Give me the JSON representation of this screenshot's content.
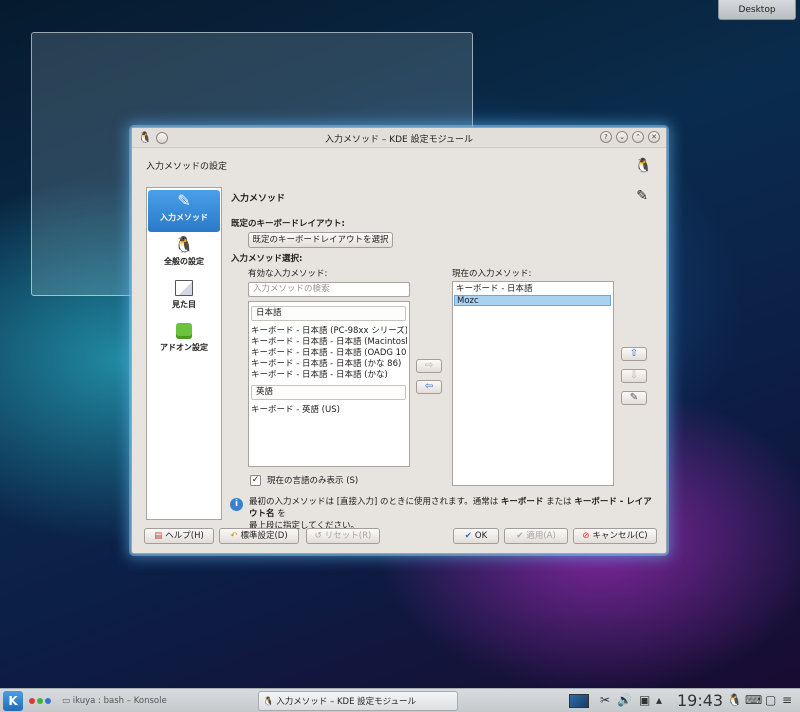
{
  "desktop": {
    "button_label": "Desktop"
  },
  "dialog": {
    "title": "入力メソッド – KDE 設定モジュール",
    "header_label": "入力メソッドの設定",
    "sidebar": [
      {
        "label": "入力メソッド",
        "icon": "pen-icon",
        "selected": true
      },
      {
        "label": "全般の設定",
        "icon": "tux-icon",
        "selected": false
      },
      {
        "label": "見た目",
        "icon": "appearance-icon",
        "selected": false
      },
      {
        "label": "アドオン設定",
        "icon": "puzzle-icon",
        "selected": false
      }
    ],
    "page_title": "入力メソッド",
    "default_layout_label": "既定のキーボードレイアウト:",
    "select_layout_button": "既定のキーボードレイアウトを選択",
    "im_selection_label": "入力メソッド選択:",
    "available_label": "有効な入力メソッド:",
    "search_placeholder": "入力メソッドの検索",
    "available_groups": [
      {
        "header": "日本語",
        "items": [
          "キーボード - 日本語 (PC-98xx シリーズ)",
          "キーボード - 日本語 - 日本語 (Macintosh)",
          "キーボード - 日本語 - 日本語 (OADG 109A)",
          "キーボード - 日本語 - 日本語 (かな 86)",
          "キーボード - 日本語 - 日本語 (かな)"
        ]
      },
      {
        "header": "英語",
        "items": [
          "キーボード - 英語 (US)"
        ]
      }
    ],
    "current_label": "現在の入力メソッド:",
    "current_items": [
      {
        "label": "キーボード - 日本語",
        "selected": false
      },
      {
        "label": "Mozc",
        "selected": true
      }
    ],
    "show_current_lang_only": {
      "label": "現在の言語のみ表示 (S)",
      "checked": true
    },
    "info_line1_pre": "最初の入力メソッドは [直接入力] のときに使用されます。通常は ",
    "info_bold1": "キーボード",
    "info_mid": " または ",
    "info_bold2": "キーボード - レイアウト名",
    "info_post": " を",
    "info_line2": "最上段に指定してください。",
    "buttons": {
      "help": "ヘルプ(H)",
      "defaults": "標準設定(D)",
      "reset": "リセット(R)",
      "ok": "OK",
      "apply": "適用(A)",
      "cancel": "キャンセル(C)"
    }
  },
  "taskbar": {
    "tasks": [
      "ikuya : bash – Konsole",
      "入力メソッド – KDE 設定モジュール"
    ],
    "clock": "19:43"
  }
}
